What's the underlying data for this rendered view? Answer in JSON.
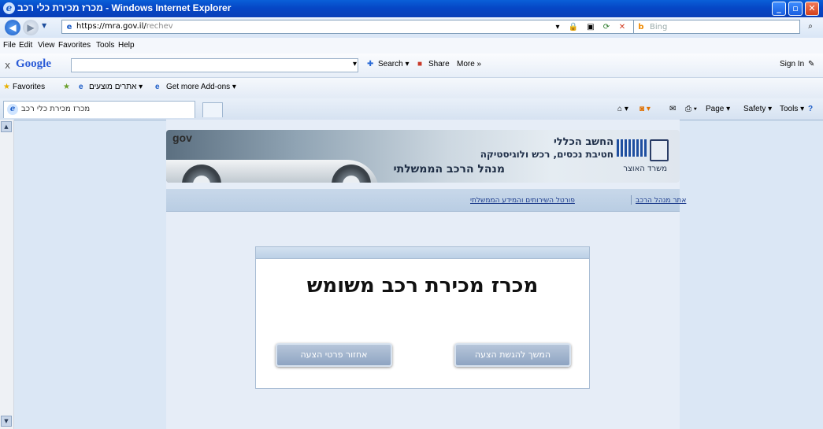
{
  "window": {
    "title": "מכרז מכירת כלי רכב - Windows Internet Explorer",
    "min": "_",
    "max": "▫",
    "close": "✕"
  },
  "address": {
    "url_host": "https://mra.gov.il/",
    "url_path": "rechev",
    "search_placeholder": "Bing"
  },
  "menu": {
    "items": [
      "File",
      "Edit",
      "View",
      "Favorites",
      "Tools",
      "Help"
    ]
  },
  "google_bar": {
    "close": "x",
    "logo": "Google",
    "search_label": "Search ▾",
    "share_label": "Share",
    "more_label": "More »",
    "signin_label": "Sign In"
  },
  "favorites_bar": {
    "favorites_label": "Favorites",
    "suggested_sites": "אתרים מוצעים ▾",
    "addons": "Get more Add-ons ▾"
  },
  "tab": {
    "title": "מכרז מכירת כלי רכב"
  },
  "command_bar": {
    "page": "Page ▾",
    "safety": "Safety ▾",
    "tools": "Tools ▾"
  },
  "banner": {
    "gov_logo": "gov",
    "line1": "החשב הכללי",
    "line2": "חטיבת נכסים, רכש ולוגיסטיקה",
    "line3": "מנהל הרכב הממשלתי",
    "ministry": "משרד האוצר"
  },
  "links": {
    "vehicle_admin": "אתר מנהל הרכב",
    "gov_portal": "פורטל השירותים והמידע הממשלתי"
  },
  "main": {
    "heading": "מכרז מכירת רכב משומש",
    "continue_button": "המשך להגשת הצעה",
    "restore_button": "אחזור פרטי הצעה"
  }
}
